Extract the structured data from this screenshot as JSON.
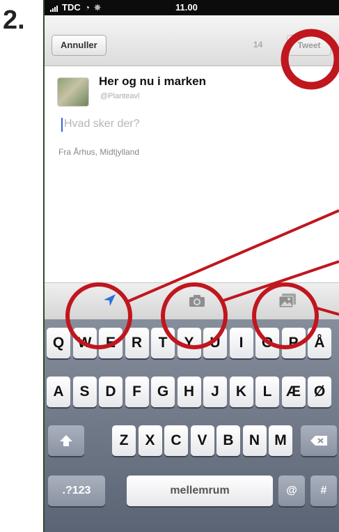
{
  "step_number": "2.",
  "status_bar": {
    "carrier": "TDC",
    "time": "11.00",
    "signal_icon": "signal-bars-icon",
    "wifi_icon": "wifi-icon"
  },
  "nav": {
    "cancel_label": "Annuller",
    "counter": "14",
    "tweet_label": "Tweet"
  },
  "compose": {
    "account_name": "Her og nu i marken",
    "account_handle": "@Planteavl",
    "placeholder": "Hvad sker der?",
    "location": "Fra Århus, Midtjylland"
  },
  "toolbar": {
    "icons": [
      "location-arrow-icon",
      "camera-icon",
      "photo-gallery-icon"
    ]
  },
  "keyboard": {
    "row1": [
      "Q",
      "W",
      "E",
      "R",
      "T",
      "Y",
      "U",
      "I",
      "O",
      "P",
      "Å"
    ],
    "row2": [
      "A",
      "S",
      "D",
      "F",
      "G",
      "H",
      "J",
      "K",
      "L",
      "Æ",
      "Ø"
    ],
    "row3": [
      "Z",
      "X",
      "C",
      "V",
      "B",
      "N",
      "M"
    ],
    "numbers_label": ".?123",
    "space_label": "mellemrum",
    "at_label": "@",
    "hash_label": "#"
  },
  "colors": {
    "annotation": "#c0161e",
    "cursor": "#3a63e0",
    "keyboard_bg": "#6d7585"
  }
}
